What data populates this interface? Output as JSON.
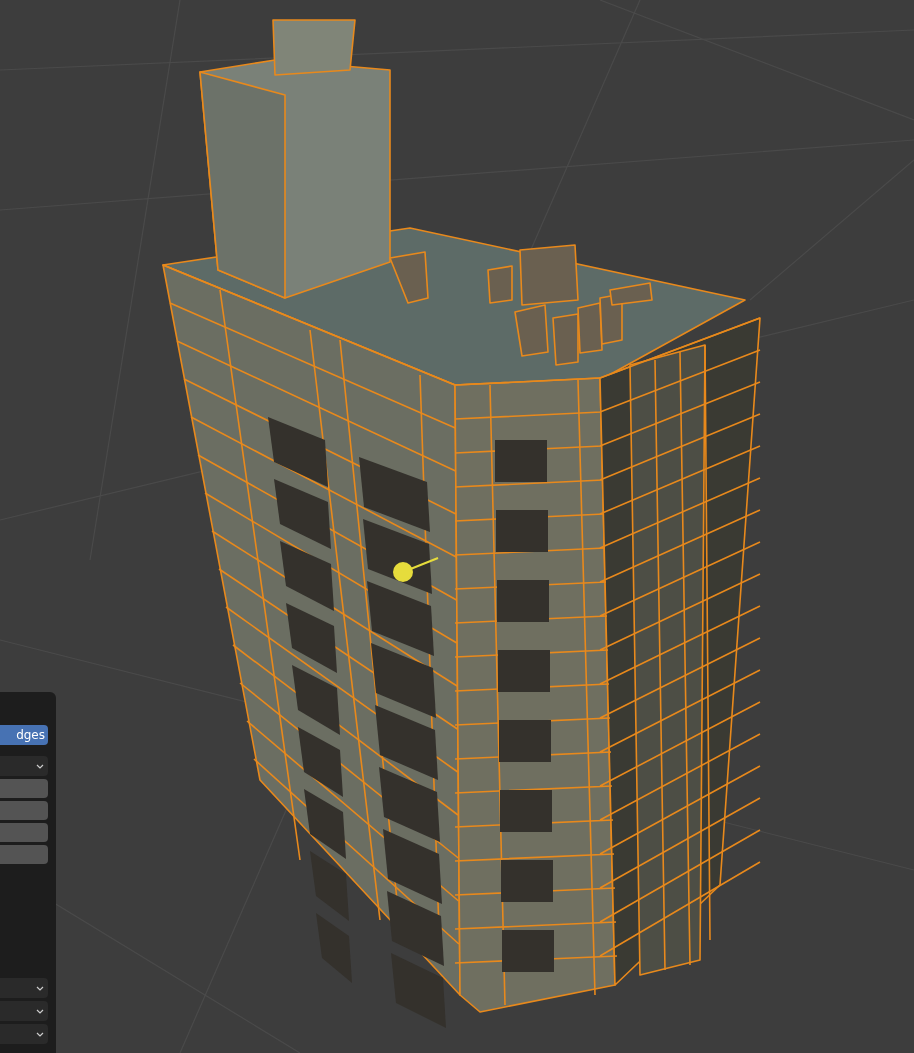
{
  "side_panel": {
    "controls": [
      {
        "kind": "button",
        "label": "dges",
        "selected": true
      },
      {
        "kind": "dropdown"
      },
      {
        "kind": "field"
      },
      {
        "kind": "field"
      },
      {
        "kind": "field"
      },
      {
        "kind": "field"
      },
      {
        "kind": "spacer"
      },
      {
        "kind": "dropdown"
      },
      {
        "kind": "dropdown"
      },
      {
        "kind": "dropdown"
      }
    ]
  }
}
